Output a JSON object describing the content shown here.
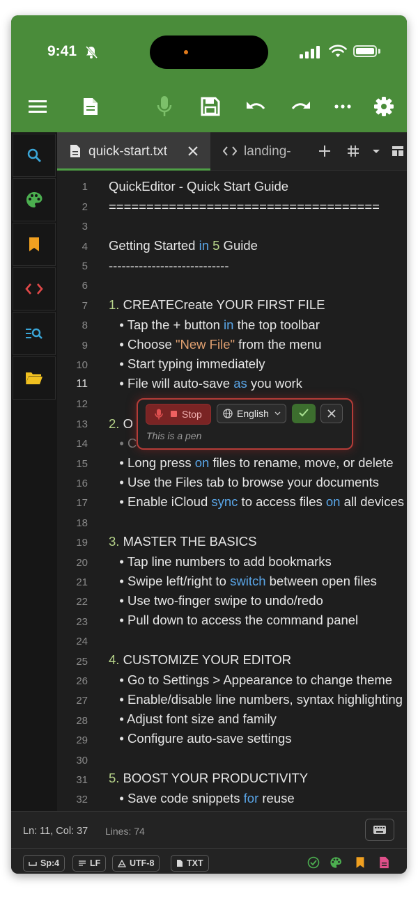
{
  "status_bar": {
    "time": "9:41"
  },
  "toolbar": {
    "icons": [
      "menu-icon",
      "document-icon",
      "microphone-icon",
      "save-icon",
      "undo-icon",
      "redo-icon",
      "more-icon",
      "settings-icon"
    ],
    "accent": "#4a8c3a"
  },
  "sidebar": {
    "items": [
      {
        "icon": "search-icon",
        "color": "#3aa6d8"
      },
      {
        "icon": "palette-icon",
        "color": "#4caf50"
      },
      {
        "icon": "bookmark-icon",
        "color": "#f0a020"
      },
      {
        "icon": "code-icon",
        "color": "#e04848"
      },
      {
        "icon": "search-list-icon",
        "color": "#3aa6d8"
      },
      {
        "icon": "folder-icon",
        "color": "#f0c020"
      }
    ]
  },
  "tabs": [
    {
      "label": "quick-start.txt",
      "active": true
    },
    {
      "label": "landing-",
      "active": false
    }
  ],
  "editor": {
    "line_numbers": [
      "1",
      "2",
      "3",
      "4",
      "5",
      "6",
      "7",
      "8",
      "9",
      "10",
      "11",
      "12",
      "13",
      "14",
      "15",
      "16",
      "17",
      "18",
      "19",
      "20",
      "21",
      "22",
      "23",
      "24",
      "25",
      "26",
      "27",
      "28",
      "29",
      "30",
      "31",
      "32"
    ],
    "current_line": "11"
  },
  "voice_dialog": {
    "stop_label": "Stop",
    "language": "English",
    "transcript": "This is a pen"
  },
  "status": {
    "position": "Ln: 11, Col: 37",
    "lines": "Lines: 74",
    "chips": {
      "spaces": "Sp:4",
      "line_ending": "LF",
      "encoding": "UTF-8",
      "file_type": "TXT"
    }
  }
}
